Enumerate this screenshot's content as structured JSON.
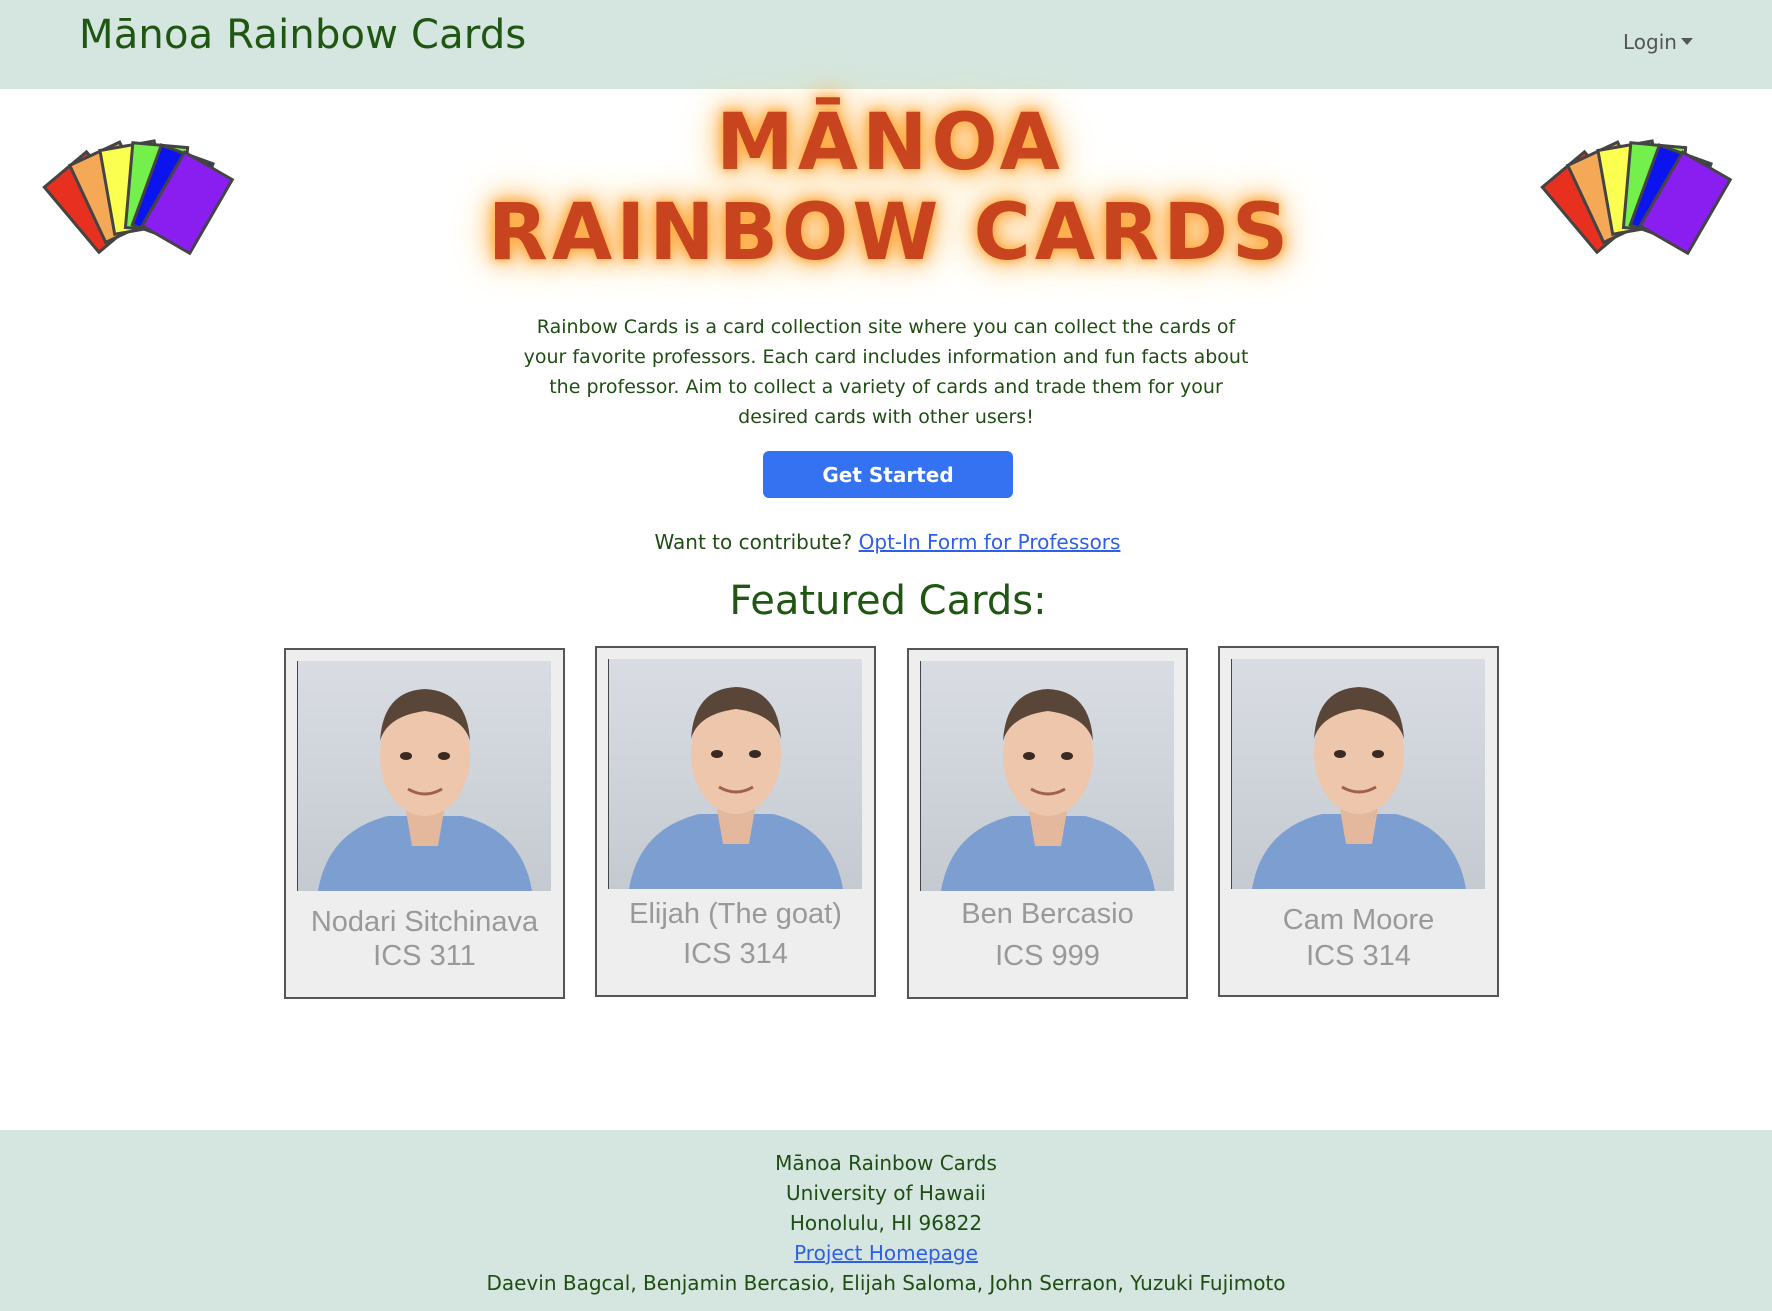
{
  "navbar": {
    "brand": "Mānoa Rainbow Cards",
    "login_label": "Login"
  },
  "hero": {
    "title_line1": "MĀNOA",
    "title_line2": "RAINBOW CARDS",
    "description": "Rainbow Cards is a card collection site where you can collect the cards of your favorite professors. Each card includes information and fun facts about the professor. Aim to collect a variety of cards and trade them for your desired cards with other users!",
    "get_started_label": "Get Started",
    "contribute_text": "Want to contribute?",
    "contribute_link": "Opt-In Form for Professors"
  },
  "featured": {
    "title": "Featured Cards:",
    "cards": [
      {
        "name": "Nodari Sitchinava",
        "course": "ICS 311"
      },
      {
        "name": "Elijah (The goat)",
        "course": "ICS 314"
      },
      {
        "name": "Ben Bercasio",
        "course": "ICS 999"
      },
      {
        "name": "Cam Moore",
        "course": "ICS 314"
      }
    ]
  },
  "footer": {
    "line1": "Mānoa Rainbow Cards",
    "line2": "University of Hawaii",
    "line3": "Honolulu, HI 96822",
    "link": "Project Homepage",
    "authors": "Daevin Bagcal, Benjamin Bercasio, Elijah Saloma, John Serraon, Yuzuki Fujimoto"
  },
  "colors": {
    "nav_bg": "#d4e6df",
    "brand_green": "#1f5612",
    "button_blue": "#3472f2",
    "link_blue": "#2f5fe4",
    "title_orange": "#c8441e"
  },
  "fan_colors": [
    "#e83020",
    "#f5a855",
    "#fbff4f",
    "#73f04c",
    "#0b14ee",
    "#8a1ef0"
  ]
}
